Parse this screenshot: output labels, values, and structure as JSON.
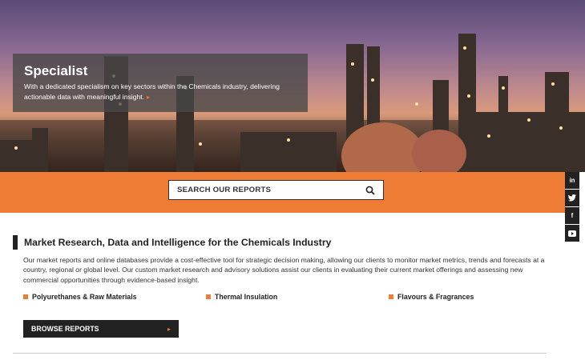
{
  "hero": {
    "title": "Specialist",
    "text": "With a dedicated specialism on key sectors within the Chemicals industry, delivering actionable data with meaningful insight.",
    "arrow": "▸"
  },
  "search": {
    "placeholder": "SEARCH OUR REPORTS",
    "icon": "search-icon"
  },
  "social": [
    {
      "label": "in",
      "icon": "linkedin-icon"
    },
    {
      "label": "🐦",
      "icon": "twitter-icon"
    },
    {
      "label": "f",
      "icon": "facebook-icon"
    },
    {
      "label": "▶",
      "icon": "youtube-icon"
    }
  ],
  "main": {
    "title": "Market Research, Data and Intelligence for the Chemicals Industry",
    "intro": "Our market reports and online databases provide a cost-effective tool for strategic decision making, allowing our clients to monitor market metrics, trends and forecasts at a country, regional or global level. Our custom market research and advisory solutions assist our clients in evaluating their current market offerings and assessing new commercial opportunities through evidence-based insight.",
    "categories": [
      {
        "label": "Polyurethanes & Raw Materials"
      },
      {
        "label": "Thermal Insulation"
      },
      {
        "label": "Flavours & Fragrances"
      }
    ],
    "browse_label": "BROWSE REPORTS",
    "browse_arrow": "▸"
  },
  "colors": {
    "accent": "#ef7c35",
    "dark": "#222222"
  }
}
